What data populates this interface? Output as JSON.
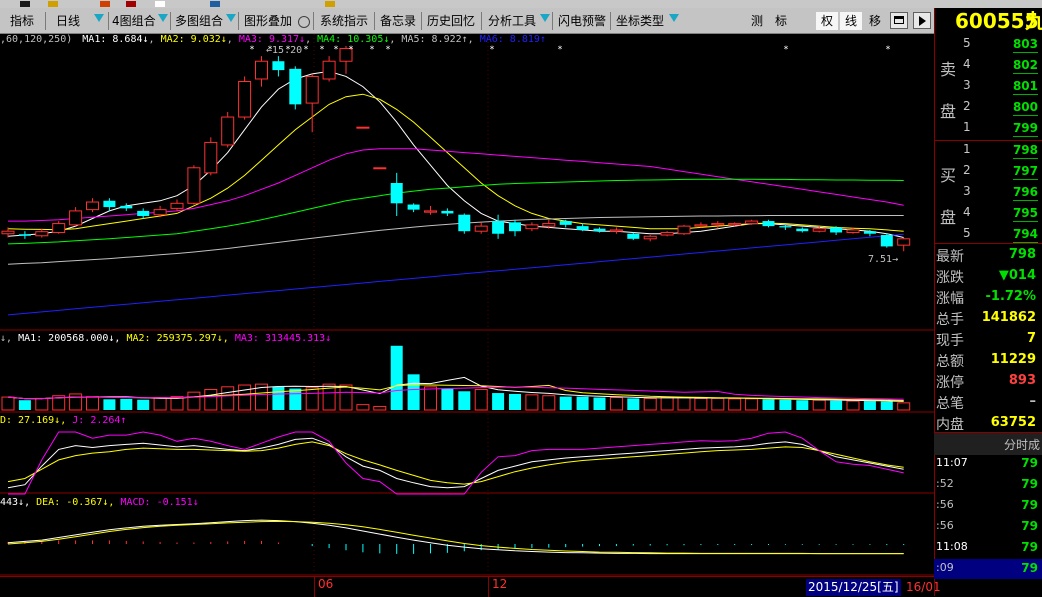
{
  "toolbar": {
    "items": [
      "指标",
      "日线",
      "4图组合",
      "多图组合",
      "图形叠加",
      "系统指示",
      "备忘录",
      "历史回忆",
      "分析工具",
      "闪电预警",
      "坐标类型"
    ],
    "right_items": [
      "测",
      "标",
      "权",
      "线",
      "移"
    ]
  },
  "stock": {
    "code": "600555",
    "name_partial": "九"
  },
  "main_legend": {
    "prefix": ",60,120,250)",
    "ma1": "MA1: 8.684↓",
    "ma2": "MA2: 9.032↓",
    "ma3": "MA3: 9.317↓",
    "ma4": "MA4: 10.305↓",
    "ma5": "MA5: 8.922↑",
    "ma6": "MA6: 8.819↑"
  },
  "annotations": {
    "high": "15.20",
    "low": "7.51"
  },
  "vol_legend": {
    "prefix": "↓,",
    "ma1": "MA1: 200568.000↓,",
    "ma2": "MA2: 259375.297↓,",
    "ma3": "MA3: 313445.313↓"
  },
  "kdj_legend": {
    "d": "D: 27.169↓,",
    "j": "J: 2.264↑"
  },
  "macd_legend": {
    "dif": "443↓,",
    "dea": "DEA: -0.367↓,",
    "macd": "MACD: -0.151↓"
  },
  "date_axis": {
    "mark1": "06",
    "mark2": "12",
    "selected_date": "2015/12/25[五]",
    "end_label": "16/01"
  },
  "order_book": {
    "sell_label_1": "卖",
    "sell_label_2": "盘",
    "buy_label_1": "买",
    "buy_label_2": "盘",
    "sell": [
      {
        "level": "5",
        "price": "803"
      },
      {
        "level": "4",
        "price": "802"
      },
      {
        "level": "3",
        "price": "801"
      },
      {
        "level": "2",
        "price": "800"
      },
      {
        "level": "1",
        "price": "799"
      }
    ],
    "buy": [
      {
        "level": "1",
        "price": "798"
      },
      {
        "level": "2",
        "price": "797"
      },
      {
        "level": "3",
        "price": "796"
      },
      {
        "level": "4",
        "price": "795"
      },
      {
        "level": "5",
        "price": "794"
      }
    ]
  },
  "quote": [
    {
      "label": "最新",
      "value": "798",
      "color": "#00e000"
    },
    {
      "label": "涨跌",
      "value": "▼014",
      "color": "#00e000"
    },
    {
      "label": "涨幅",
      "value": "-1.72%",
      "color": "#00e000"
    },
    {
      "label": "总手",
      "value": "141862",
      "color": "#ffff00"
    },
    {
      "label": "现手",
      "value": "7",
      "color": "#ffff00"
    },
    {
      "label": "总额",
      "value": "11229",
      "color": "#ffff00"
    },
    {
      "label": "涨停",
      "value": "893",
      "color": "#ff4040"
    },
    {
      "label": "总笔",
      "value": "–",
      "color": "#c0c0c0"
    },
    {
      "label": "内盘",
      "value": "63752",
      "color": "#ffff00"
    }
  ],
  "ticks": {
    "header": "分时成",
    "rows": [
      {
        "time": "11:07",
        "price": "79"
      },
      {
        "time": ":52",
        "price": "79"
      },
      {
        "time": ":56",
        "price": "79"
      },
      {
        "time": ":56",
        "price": "79"
      },
      {
        "time": "11:08",
        "price": "79"
      },
      {
        "time": ":09",
        "price": "79"
      }
    ]
  },
  "colors": {
    "up": "#ff3030",
    "down": "#00ffff",
    "ma1": "#ffffff",
    "ma2": "#ffff00",
    "ma3": "#ff00ff",
    "ma4": "#00ff00",
    "ma5": "#c0c0c0",
    "ma6": "#2020ff",
    "panel_border": "#8a0000"
  },
  "chart_data": {
    "type": "candlestick",
    "x_axis_labels": [
      "06",
      "12"
    ],
    "candles": [
      [
        8.2,
        8.3,
        8.05,
        8.45
      ],
      [
        8.18,
        8.12,
        8.0,
        8.3
      ],
      [
        8.12,
        8.28,
        8.05,
        8.4
      ],
      [
        8.25,
        8.6,
        8.2,
        8.7
      ],
      [
        8.55,
        9.1,
        8.5,
        9.25
      ],
      [
        9.15,
        9.45,
        9.05,
        9.6
      ],
      [
        9.5,
        9.25,
        9.1,
        9.6
      ],
      [
        9.3,
        9.2,
        9.1,
        9.4
      ],
      [
        9.1,
        8.9,
        8.8,
        9.2
      ],
      [
        8.95,
        9.15,
        8.85,
        9.3
      ],
      [
        9.2,
        9.4,
        9.1,
        9.55
      ],
      [
        9.4,
        10.8,
        9.35,
        10.9
      ],
      [
        10.6,
        11.8,
        10.5,
        12.0
      ],
      [
        11.7,
        12.8,
        11.6,
        13.0
      ],
      [
        12.8,
        14.2,
        12.7,
        14.4
      ],
      [
        14.3,
        15.0,
        14.0,
        15.2
      ],
      [
        15.0,
        14.65,
        14.4,
        15.2
      ],
      [
        14.7,
        13.3,
        13.1,
        14.8
      ],
      [
        13.35,
        14.4,
        12.2,
        14.5
      ],
      [
        14.3,
        15.0,
        14.2,
        15.2
      ],
      [
        15.0,
        15.5,
        14.5,
        15.6
      ],
      [
        12.4,
        12.4,
        12.4,
        12.4
      ],
      [
        10.8,
        10.8,
        10.8,
        10.8
      ],
      [
        10.2,
        9.4,
        8.9,
        10.6
      ],
      [
        9.35,
        9.15,
        9.05,
        9.4
      ],
      [
        9.05,
        9.1,
        8.95,
        9.3
      ],
      [
        9.1,
        9.0,
        8.9,
        9.2
      ],
      [
        8.95,
        8.3,
        8.2,
        9.0
      ],
      [
        8.3,
        8.5,
        8.2,
        8.65
      ],
      [
        8.7,
        8.2,
        8.0,
        8.95
      ],
      [
        8.65,
        8.3,
        8.1,
        8.75
      ],
      [
        8.4,
        8.55,
        8.3,
        8.65
      ],
      [
        8.5,
        8.6,
        8.4,
        8.75
      ],
      [
        8.7,
        8.55,
        8.45,
        8.75
      ],
      [
        8.5,
        8.35,
        8.3,
        8.6
      ],
      [
        8.4,
        8.3,
        8.25,
        8.45
      ],
      [
        8.3,
        8.35,
        8.2,
        8.45
      ],
      [
        8.2,
        8.0,
        7.95,
        8.25
      ],
      [
        8.0,
        8.1,
        7.9,
        8.15
      ],
      [
        8.15,
        8.25,
        8.1,
        8.3
      ],
      [
        8.2,
        8.5,
        8.15,
        8.55
      ],
      [
        8.5,
        8.55,
        8.45,
        8.65
      ],
      [
        8.55,
        8.6,
        8.4,
        8.7
      ],
      [
        8.55,
        8.6,
        8.5,
        8.65
      ],
      [
        8.6,
        8.7,
        8.55,
        8.75
      ],
      [
        8.7,
        8.5,
        8.45,
        8.75
      ],
      [
        8.5,
        8.45,
        8.35,
        8.55
      ],
      [
        8.4,
        8.3,
        8.25,
        8.45
      ],
      [
        8.3,
        8.4,
        8.25,
        8.5
      ],
      [
        8.45,
        8.25,
        8.15,
        8.5
      ],
      [
        8.25,
        8.35,
        8.2,
        8.45
      ],
      [
        8.3,
        8.2,
        8.1,
        8.35
      ],
      [
        8.15,
        7.7,
        7.65,
        8.2
      ],
      [
        7.75,
        8.0,
        7.51,
        8.05
      ]
    ],
    "ma_series": [
      {
        "name": "MA1",
        "values": [
          8.1,
          8.15,
          8.2,
          8.3,
          8.5,
          8.8,
          9.1,
          9.3,
          9.4,
          9.5,
          9.7,
          10.1,
          10.7,
          11.4,
          12.3,
          13.2,
          13.9,
          14.3,
          14.5,
          14.6,
          14.4,
          14.0,
          13.4,
          12.6,
          11.7,
          10.9,
          10.1,
          9.5,
          9.0,
          8.7,
          8.6,
          8.5,
          8.45,
          8.4,
          8.35,
          8.3,
          8.3,
          8.25,
          8.2,
          8.2,
          8.25,
          8.3,
          8.4,
          8.5,
          8.6,
          8.6,
          8.55,
          8.5,
          8.45,
          8.4,
          8.35,
          8.3,
          8.2,
          8.05
        ]
      },
      {
        "name": "MA2",
        "values": [
          8.4,
          8.38,
          8.37,
          8.36,
          8.4,
          8.5,
          8.6,
          8.7,
          8.8,
          8.9,
          9.0,
          9.3,
          9.6,
          10.0,
          10.5,
          11.1,
          11.7,
          12.3,
          12.8,
          13.3,
          13.6,
          13.7,
          13.5,
          13.1,
          12.6,
          12.0,
          11.4,
          10.8,
          10.2,
          9.7,
          9.3,
          9.0,
          8.8,
          8.7,
          8.6,
          8.55,
          8.5,
          8.45,
          8.4,
          8.4,
          8.4,
          8.45,
          8.5,
          8.55,
          8.6,
          8.62,
          8.6,
          8.55,
          8.5,
          8.45,
          8.42,
          8.4,
          8.35,
          8.3
        ]
      },
      {
        "name": "MA3",
        "values": [
          8.7,
          8.7,
          8.72,
          8.75,
          8.8,
          8.85,
          8.9,
          8.95,
          9.0,
          9.05,
          9.1,
          9.2,
          9.35,
          9.5,
          9.7,
          9.95,
          10.2,
          10.5,
          10.8,
          11.1,
          11.35,
          11.5,
          11.55,
          11.55,
          11.55,
          11.5,
          11.45,
          11.4,
          11.35,
          11.3,
          11.25,
          11.2,
          11.15,
          11.1,
          11.05,
          11.0,
          10.95,
          10.9,
          10.85,
          10.75,
          10.65,
          10.55,
          10.45,
          10.35,
          10.25,
          10.15,
          10.05,
          9.95,
          9.85,
          9.75,
          9.65,
          9.55,
          9.45,
          9.32
        ]
      },
      {
        "name": "MA4",
        "values": [
          7.8,
          7.82,
          7.85,
          7.88,
          7.92,
          7.96,
          8.0,
          8.05,
          8.1,
          8.15,
          8.2,
          8.3,
          8.4,
          8.5,
          8.62,
          8.75,
          8.9,
          9.05,
          9.2,
          9.35,
          9.5,
          9.6,
          9.7,
          9.8,
          9.88,
          9.95,
          10.0,
          10.05,
          10.1,
          10.15,
          10.18,
          10.2,
          10.22,
          10.24,
          10.26,
          10.28,
          10.3,
          10.31,
          10.32,
          10.33,
          10.34,
          10.35,
          10.35,
          10.35,
          10.35,
          10.34,
          10.34,
          10.33,
          10.33,
          10.32,
          10.32,
          10.31,
          10.31,
          10.3
        ]
      },
      {
        "name": "MA5",
        "values": [
          7.0,
          7.03,
          7.06,
          7.1,
          7.14,
          7.18,
          7.22,
          7.27,
          7.32,
          7.37,
          7.42,
          7.48,
          7.55,
          7.62,
          7.7,
          7.78,
          7.86,
          7.94,
          8.02,
          8.1,
          8.18,
          8.26,
          8.33,
          8.4,
          8.46,
          8.52,
          8.57,
          8.62,
          8.66,
          8.7,
          8.73,
          8.76,
          8.78,
          8.8,
          8.82,
          8.84,
          8.85,
          8.86,
          8.87,
          8.88,
          8.89,
          8.9,
          8.9,
          8.91,
          8.91,
          8.92,
          8.92,
          8.92,
          8.92,
          8.92,
          8.92,
          8.92,
          8.92,
          8.92
        ]
      },
      {
        "name": "MA6",
        "values": [
          5.0,
          5.06,
          5.12,
          5.18,
          5.24,
          5.3,
          5.36,
          5.42,
          5.48,
          5.54,
          5.6,
          5.66,
          5.72,
          5.78,
          5.84,
          5.9,
          5.96,
          6.02,
          6.08,
          6.14,
          6.2,
          6.26,
          6.32,
          6.38,
          6.44,
          6.5,
          6.56,
          6.62,
          6.68,
          6.74,
          6.8,
          6.86,
          6.92,
          6.98,
          7.04,
          7.1,
          7.16,
          7.22,
          7.28,
          7.34,
          7.4,
          7.46,
          7.52,
          7.58,
          7.64,
          7.7,
          7.76,
          7.82,
          7.88,
          7.94,
          8.0,
          8.06,
          8.12,
          8.18
        ]
      }
    ],
    "volume": [
      145000,
      110000,
      130000,
      160000,
      180000,
      150000,
      120000,
      125000,
      115000,
      140000,
      150000,
      200000,
      230000,
      260000,
      280000,
      290000,
      260000,
      240000,
      250000,
      290000,
      280000,
      60000,
      40000,
      720000,
      400000,
      260000,
      240000,
      210000,
      230000,
      190000,
      180000,
      170000,
      160000,
      150000,
      150000,
      140000,
      140000,
      130000,
      130000,
      140000,
      140000,
      130000,
      130000,
      125000,
      125000,
      120000,
      115000,
      110000,
      110000,
      105000,
      100000,
      100000,
      95000,
      80000
    ],
    "kdj": {
      "k": [
        10,
        15,
        45,
        72,
        78,
        75,
        78,
        80,
        82,
        79,
        76,
        78,
        75,
        72,
        70,
        74,
        80,
        88,
        90,
        80,
        60,
        45,
        38,
        25,
        18,
        12,
        10,
        12,
        25,
        38,
        45,
        52,
        55,
        58,
        60,
        62,
        64,
        66,
        68,
        70,
        72,
        74,
        75,
        76,
        78,
        82,
        84,
        80,
        70,
        60,
        55,
        50,
        45,
        40
      ],
      "d": [
        20,
        25,
        40,
        55,
        62,
        66,
        68,
        72,
        74,
        73,
        72,
        72,
        71,
        70,
        69,
        70,
        74,
        80,
        84,
        78,
        65,
        55,
        47,
        38,
        30,
        22,
        18,
        16,
        20,
        28,
        36,
        42,
        47,
        51,
        54,
        56,
        58,
        60,
        62,
        64,
        66,
        68,
        70,
        71,
        72,
        74,
        76,
        75,
        70,
        64,
        58,
        52,
        47,
        43
      ],
      "j": [
        0,
        0,
        55,
        100,
        100,
        90,
        95,
        95,
        100,
        95,
        85,
        90,
        85,
        78,
        72,
        82,
        92,
        100,
        100,
        85,
        50,
        25,
        20,
        0,
        0,
        0,
        0,
        0,
        35,
        60,
        62,
        70,
        72,
        72,
        72,
        74,
        76,
        78,
        80,
        82,
        84,
        86,
        85,
        86,
        90,
        98,
        100,
        90,
        70,
        52,
        48,
        46,
        40,
        34
      ]
    },
    "macd": {
      "dif": [
        0.05,
        0.1,
        0.15,
        0.25,
        0.35,
        0.45,
        0.55,
        0.62,
        0.68,
        0.72,
        0.75,
        0.78,
        0.82,
        0.86,
        0.9,
        0.92,
        0.9,
        0.86,
        0.8,
        0.72,
        0.62,
        0.5,
        0.38,
        0.26,
        0.15,
        0.05,
        -0.05,
        -0.12,
        -0.18,
        -0.22,
        -0.26,
        -0.29,
        -0.31,
        -0.33,
        -0.34,
        -0.35,
        -0.36,
        -0.36,
        -0.37,
        -0.37,
        -0.37,
        -0.37,
        -0.37,
        -0.37,
        -0.37,
        -0.37,
        -0.37,
        -0.37,
        -0.37,
        -0.37,
        -0.37,
        -0.37,
        -0.37,
        -0.37
      ],
      "dea": [
        0.0,
        0.05,
        0.1,
        0.18,
        0.28,
        0.38,
        0.48,
        0.56,
        0.63,
        0.68,
        0.72,
        0.75,
        0.78,
        0.81,
        0.84,
        0.86,
        0.87,
        0.86,
        0.84,
        0.8,
        0.74,
        0.66,
        0.56,
        0.45,
        0.34,
        0.23,
        0.12,
        0.02,
        -0.06,
        -0.12,
        -0.17,
        -0.21,
        -0.24,
        -0.27,
        -0.29,
        -0.31,
        -0.32,
        -0.33,
        -0.34,
        -0.35,
        -0.35,
        -0.36,
        -0.36,
        -0.36,
        -0.36,
        -0.36,
        -0.36,
        -0.36,
        -0.37,
        -0.37,
        -0.37,
        -0.37,
        -0.37,
        -0.37
      ],
      "macd": [
        0.08,
        0.1,
        0.12,
        0.14,
        0.14,
        0.14,
        0.14,
        0.12,
        0.1,
        0.08,
        0.06,
        0.06,
        0.08,
        0.1,
        0.12,
        0.12,
        0.06,
        0.0,
        -0.08,
        -0.16,
        -0.24,
        -0.32,
        -0.36,
        -0.38,
        -0.38,
        -0.36,
        -0.34,
        -0.28,
        -0.24,
        -0.2,
        -0.18,
        -0.16,
        -0.14,
        -0.12,
        -0.1,
        -0.08,
        -0.08,
        -0.06,
        -0.06,
        -0.05,
        -0.05,
        -0.04,
        -0.04,
        -0.04,
        -0.04,
        -0.04,
        -0.03,
        -0.03,
        -0.03,
        -0.03,
        -0.03,
        -0.03,
        -0.04,
        -0.04
      ]
    }
  }
}
